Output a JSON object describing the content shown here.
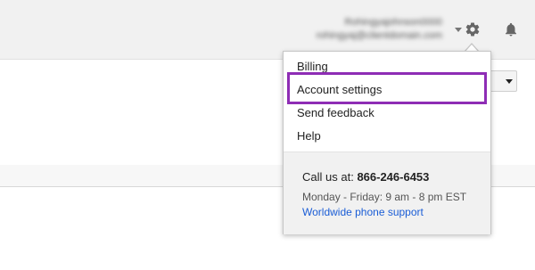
{
  "header": {
    "account_name": "Rohingyajohnson0000",
    "account_email": "rohingyaj@clientdomain.com"
  },
  "icons": {
    "settings": "gear-icon",
    "notifications": "bell-icon",
    "account_menu": "chevron-down-icon",
    "select": "chevron-down-icon"
  },
  "menu": {
    "items": [
      {
        "label": "Billing"
      },
      {
        "label": "Account settings"
      },
      {
        "label": "Send feedback"
      },
      {
        "label": "Help"
      }
    ],
    "highlighted_item": "Account settings",
    "highlight_color": "#8e2db5"
  },
  "support": {
    "call_prefix": "Call us at:",
    "phone": "866-246-6453",
    "hours": "Monday - Friday: 9 am - 8 pm EST",
    "link_label": "Worldwide phone support",
    "link_color": "#1a5dd6"
  }
}
